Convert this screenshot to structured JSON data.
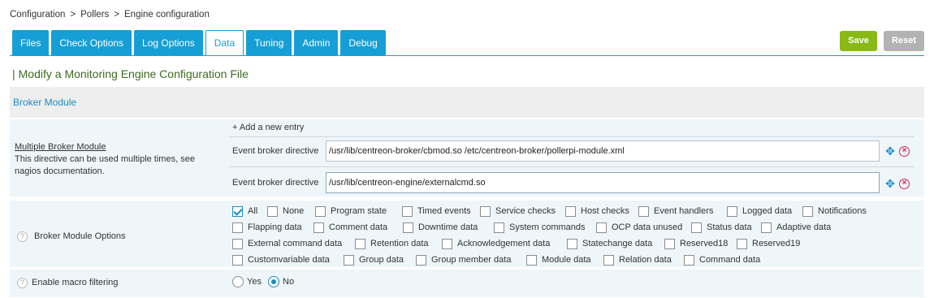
{
  "breadcrumb": [
    "Configuration",
    ">",
    "Pollers",
    ">",
    "Engine configuration"
  ],
  "tabs": [
    {
      "label": "Files",
      "active": false
    },
    {
      "label": "Check Options",
      "active": false
    },
    {
      "label": "Log Options",
      "active": false
    },
    {
      "label": "Data",
      "active": true
    },
    {
      "label": "Tuning",
      "active": false
    },
    {
      "label": "Admin",
      "active": false
    },
    {
      "label": "Debug",
      "active": false
    }
  ],
  "actions": {
    "save_label": "Save",
    "reset_label": "Reset"
  },
  "form": {
    "title_bar": "|",
    "title": "Modify a Monitoring Engine Configuration File",
    "section": "Broker Module"
  },
  "multiple_broker": {
    "title": "Multiple Broker Module",
    "description": "This directive can be used multiple times, see nagios documentation.",
    "add_entry": "+ Add a new entry",
    "entry_label": "Event broker directive",
    "entries": [
      "/usr/lib/centreon-broker/cbmod.so /etc/centreon-broker/pollerpi-module.xml",
      "/usr/lib/centreon-engine/externalcmd.so"
    ]
  },
  "broker_options": {
    "label": "Broker Module Options",
    "help": "?",
    "rows": [
      [
        {
          "label": "All",
          "checked": true
        },
        {
          "label": "None",
          "checked": false
        },
        {
          "label": "Program state",
          "checked": false
        },
        {
          "label": "Timed events",
          "checked": false
        },
        {
          "label": "Service checks",
          "checked": false
        },
        {
          "label": "Host checks",
          "checked": false
        },
        {
          "label": "Event handlers",
          "checked": false
        },
        {
          "label": "Logged data",
          "checked": false
        },
        {
          "label": "Notifications",
          "checked": false
        }
      ],
      [
        {
          "label": "Flapping data",
          "checked": false
        },
        {
          "label": "Comment data",
          "checked": false
        },
        {
          "label": "Downtime data",
          "checked": false
        },
        {
          "label": "System commands",
          "checked": false
        },
        {
          "label": "OCP data unused",
          "checked": false
        },
        {
          "label": "Status data",
          "checked": false
        },
        {
          "label": "Adaptive data",
          "checked": false
        }
      ],
      [
        {
          "label": "External command data",
          "checked": false
        },
        {
          "label": "Retention data",
          "checked": false
        },
        {
          "label": "Acknowledgement data",
          "checked": false
        },
        {
          "label": "Statechange data",
          "checked": false
        },
        {
          "label": "Reserved18",
          "checked": false
        },
        {
          "label": "Reserved19",
          "checked": false
        }
      ],
      [
        {
          "label": "Customvariable data",
          "checked": false
        },
        {
          "label": "Group data",
          "checked": false
        },
        {
          "label": "Group member data",
          "checked": false
        },
        {
          "label": "Module data",
          "checked": false
        },
        {
          "label": "Relation data",
          "checked": false
        },
        {
          "label": "Command data",
          "checked": false
        }
      ]
    ]
  },
  "macro_filtering": {
    "label": "Enable macro filtering",
    "help": "?",
    "options": [
      {
        "label": "Yes",
        "selected": false
      },
      {
        "label": "No",
        "selected": true
      }
    ]
  },
  "colors": {
    "tab": "#159fd6",
    "save": "#88b917",
    "reset": "#b3b3b3",
    "title": "#3e6b22",
    "delete": "#d9204a"
  }
}
